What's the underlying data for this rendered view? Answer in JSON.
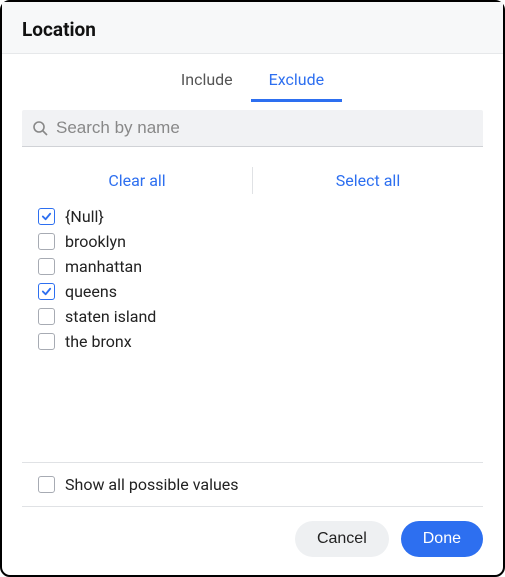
{
  "header": {
    "title": "Location"
  },
  "tabs": {
    "include": "Include",
    "exclude": "Exclude",
    "active": "exclude"
  },
  "search": {
    "placeholder": "Search by name"
  },
  "actions": {
    "clear_all": "Clear all",
    "select_all": "Select all"
  },
  "items": [
    {
      "label": "{Null}",
      "checked": true
    },
    {
      "label": "brooklyn",
      "checked": false
    },
    {
      "label": "manhattan",
      "checked": false
    },
    {
      "label": "queens",
      "checked": true
    },
    {
      "label": "staten island",
      "checked": false
    },
    {
      "label": "the bronx",
      "checked": false
    }
  ],
  "show_all": {
    "label": "Show all possible values",
    "checked": false
  },
  "footer": {
    "cancel": "Cancel",
    "done": "Done"
  }
}
